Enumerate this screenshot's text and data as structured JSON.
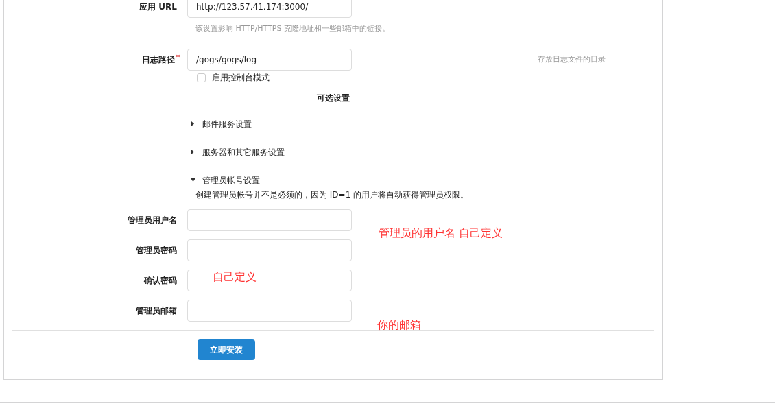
{
  "top_field": {
    "label": "应用 URL",
    "value": "http://123.57.41.174:3000/",
    "hint": "该设置影响 HTTP/HTTPS 克隆地址和一些邮箱中的链接。"
  },
  "log_field": {
    "label": "日志路径",
    "required": true,
    "value": "/gogs/gogs/log",
    "help": "存放日志文件的目录"
  },
  "console_mode": {
    "label": "启用控制台模式",
    "checked": false
  },
  "optional_header": "可选设置",
  "sections": [
    {
      "label": "邮件服务设置",
      "expanded": false
    },
    {
      "label": "服务器和其它服务设置",
      "expanded": false
    },
    {
      "label": "管理员帐号设置",
      "expanded": true
    }
  ],
  "admin_note": "创建管理员帐号并不是必须的，因为 ID=1 的用户将自动获得管理员权限。",
  "admin_fields": [
    {
      "label": "管理员用户名"
    },
    {
      "label": "管理员密码"
    },
    {
      "label": "确认密码"
    },
    {
      "label": "管理员邮箱"
    }
  ],
  "install_button": "立即安装",
  "annotations": [
    "管理员的用户名 自己定义",
    "自己定义",
    "你的邮箱"
  ]
}
